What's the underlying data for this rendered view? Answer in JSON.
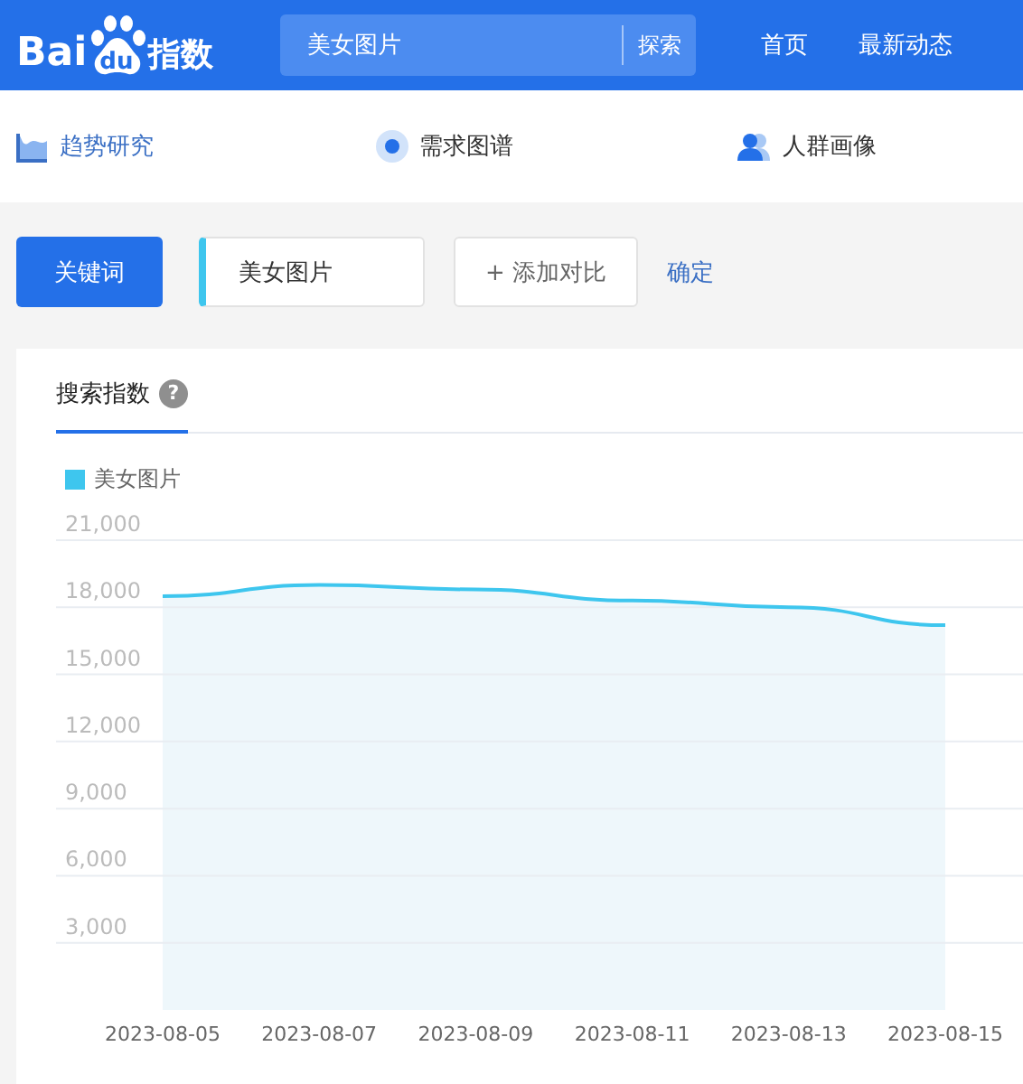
{
  "header": {
    "logo": {
      "left": "Bai",
      "paw": "du",
      "right": "指数"
    },
    "search": {
      "value": "美女图片",
      "button": "探索"
    },
    "links": [
      "首页",
      "最新动态"
    ]
  },
  "nav": [
    {
      "label": "趋势研究",
      "kind": "trend",
      "selected": true
    },
    {
      "label": "需求图谱",
      "kind": "radar",
      "selected": false
    },
    {
      "label": "人群画像",
      "kind": "people",
      "selected": false
    }
  ],
  "controls": {
    "keyword_button": "关键词",
    "keyword": "美女图片",
    "add_compare": "+ 添加对比",
    "confirm": "确定"
  },
  "card": {
    "tab": "搜索指数",
    "help": "?",
    "chart_data": {
      "type": "area",
      "grid": true,
      "categories": [
        "2023-08-05",
        "2023-08-07",
        "2023-08-09",
        "2023-08-11",
        "2023-08-13",
        "2023-08-15"
      ],
      "series": [
        {
          "name": "美女图片",
          "color": "#3ec6ee",
          "values": [
            18500,
            19000,
            18800,
            18300,
            18000,
            17200
          ]
        }
      ],
      "ylim": [
        0,
        21000
      ],
      "yticks": [
        {
          "value": 3000,
          "label": "3,000"
        },
        {
          "value": 6000,
          "label": "6,000"
        },
        {
          "value": 9000,
          "label": "9,000"
        },
        {
          "value": 12000,
          "label": "12,000"
        },
        {
          "value": 15000,
          "label": "15,000"
        },
        {
          "value": 18000,
          "label": "18,000"
        },
        {
          "value": 21000,
          "label": "21,000"
        }
      ]
    }
  }
}
